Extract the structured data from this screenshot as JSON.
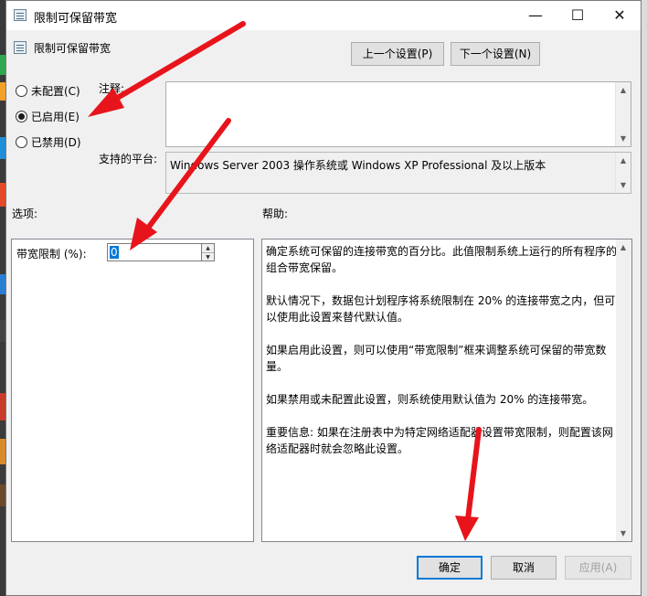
{
  "window": {
    "title": "限制可保留带宽",
    "minimize_glyph": "—",
    "maximize_glyph": "☐",
    "close_glyph": "✕"
  },
  "header": {
    "title": "限制可保留带宽",
    "prev_setting_label": "上一个设置(P)",
    "next_setting_label": "下一个设置(N)"
  },
  "state_options": [
    {
      "label": "未配置(C)",
      "checked": false
    },
    {
      "label": "已启用(E)",
      "checked": true
    },
    {
      "label": "已禁用(D)",
      "checked": false
    }
  ],
  "comment": {
    "label": "注释:",
    "value": ""
  },
  "platform": {
    "label": "支持的平台:",
    "value": "Windows Server 2003 操作系统或 Windows XP Professional 及以上版本"
  },
  "options": {
    "heading": "选项:",
    "bandwidth_label": "带宽限制 (%):",
    "bandwidth_value": "0"
  },
  "help": {
    "heading": "帮助:",
    "text": "确定系统可保留的连接带宽的百分比。此值限制系统上运行的所有程序的组合带宽保留。\n\n默认情况下，数据包计划程序将系统限制在 20% 的连接带宽之内，但可以使用此设置来替代默认值。\n\n如果启用此设置，则可以使用“带宽限制”框来调整系统可保留的带宽数量。\n\n如果禁用或未配置此设置，则系统使用默认值为 20% 的连接带宽。\n\n重要信息: 如果在注册表中为特定网络适配器设置带宽限制，则配置该网络适配器时就会忽略此设置。"
  },
  "footer": {
    "ok_label": "确定",
    "cancel_label": "取消",
    "apply_label": "应用(A)"
  },
  "colors": {
    "annotation_arrow": "#e8141b",
    "selection": "#0078d7"
  }
}
